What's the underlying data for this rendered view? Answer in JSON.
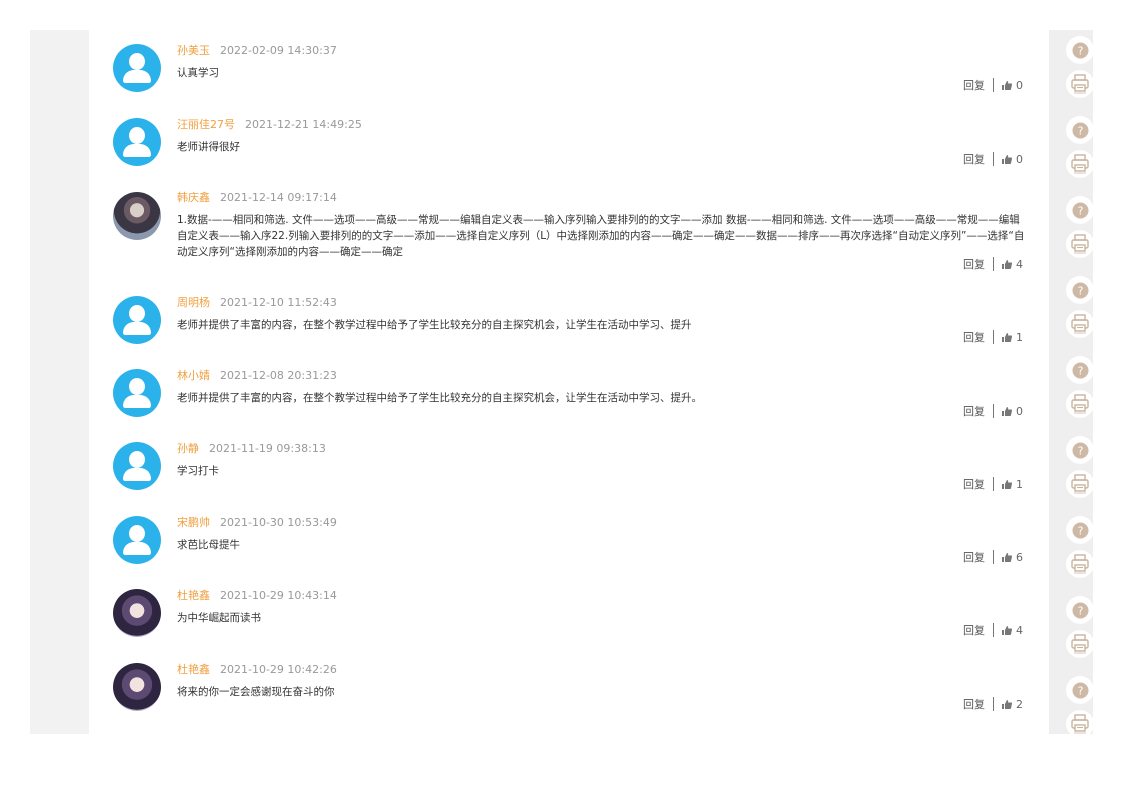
{
  "reply_label": "回复",
  "comments": [
    {
      "name": "孙美玉",
      "time": "2022-02-09 14:30:37",
      "content": "认真学习",
      "likes": "0",
      "avatar": "default-user-icon"
    },
    {
      "name": "汪丽佳27号",
      "time": "2021-12-21 14:49:25",
      "content": "老师讲得很好",
      "likes": "0",
      "avatar": "default-user-icon"
    },
    {
      "name": "韩庆鑫",
      "time": "2021-12-14 09:17:14",
      "content": "1.数据-——相同和筛选. 文件——选项——高级——常规——编辑自定义表——输入序列输入要排列的的文字——添加 数据-——相同和筛选. 文件——选项——高级——常规——编辑自定义表——输入序22.列输入要排列的的文字——添加——选择自定义序列（L）中选择刚添加的内容——确定——确定——数据——排序——再次序选择“自动定义序列”——选择“自动定义序列“选择刚添加的内容——确定——确定",
      "likes": "4",
      "avatar": "user-photo"
    },
    {
      "name": "周明杨",
      "time": "2021-12-10 11:52:43",
      "content": "老师并提供了丰富的内容，在整个教学过程中给予了学生比较充分的自主探究机会，让学生在活动中学习、提升",
      "likes": "1",
      "avatar": "default-user-icon"
    },
    {
      "name": "林小婧",
      "time": "2021-12-08 20:31:23",
      "content": "老师并提供了丰富的内容，在整个教学过程中给予了学生比较充分的自主探究机会，让学生在活动中学习、提升。",
      "likes": "0",
      "avatar": "default-user-icon"
    },
    {
      "name": "孙静",
      "time": "2021-11-19 09:38:13",
      "content": "学习打卡",
      "likes": "1",
      "avatar": "default-user-icon"
    },
    {
      "name": "宋鹏帅",
      "time": "2021-10-30 10:53:49",
      "content": "求芭比母提牛",
      "likes": "6",
      "avatar": "default-user-icon"
    },
    {
      "name": "杜艳鑫",
      "time": "2021-10-29 10:43:14",
      "content": "为中华崛起而读书",
      "likes": "4",
      "avatar": "user-photo"
    },
    {
      "name": "杜艳鑫",
      "time": "2021-10-29 10:42:26",
      "content": "将来的你一定会感谢现在奋斗的你",
      "likes": "2",
      "avatar": "user-photo"
    }
  ],
  "sidebar_icons": [
    "help-icon",
    "print-icon",
    "help-icon",
    "print-icon",
    "help-icon",
    "print-icon",
    "help-icon",
    "print-icon",
    "help-icon",
    "print-icon",
    "help-icon",
    "print-icon",
    "help-icon",
    "print-icon",
    "help-icon",
    "print-icon",
    "help-icon",
    "print-icon"
  ],
  "colors": {
    "name": "#f0a040",
    "time": "#999999",
    "avatar": "#2bb2ea",
    "side_strip": "#efefef"
  }
}
